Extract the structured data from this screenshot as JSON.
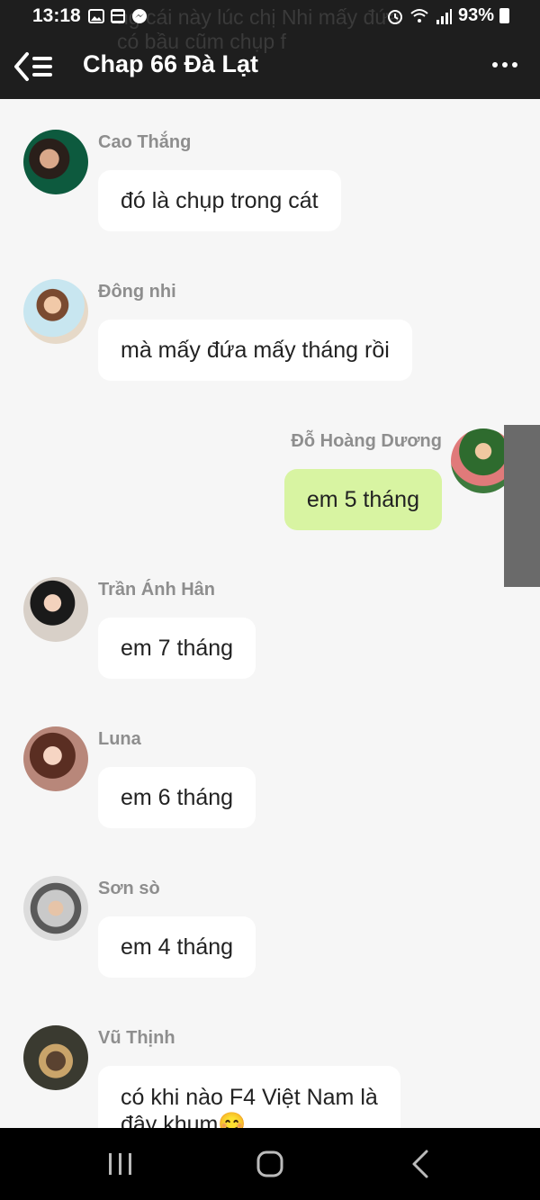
{
  "status_bar": {
    "time": "13:18",
    "battery": "93%"
  },
  "background_ghost_text": "ng cái này lúc chị Nhi mấy đứa có bầu cũm chụp f",
  "header": {
    "title": "Chap 66 Đà Lạt",
    "back_icon": "back-list-icon",
    "more_icon": "more-dots-icon"
  },
  "messages": [
    {
      "sender": "Cao Thắng",
      "text": "đó là chụp trong cát",
      "mine": false
    },
    {
      "sender": "Đông nhi",
      "text": "mà mấy đứa mấy tháng rồi",
      "mine": false
    },
    {
      "sender": "Đỗ Hoàng Dương",
      "text": "em 5 tháng",
      "mine": true
    },
    {
      "sender": "Trần Ánh Hân",
      "text": "em 7 tháng",
      "mine": false
    },
    {
      "sender": "Luna",
      "text": "em 6 tháng",
      "mine": false
    },
    {
      "sender": "Sơn sò",
      "text": "em 4 tháng",
      "mine": false
    },
    {
      "sender": "Vũ Thịnh",
      "text_line1": "có khi nào F4 Việt Nam là",
      "text_line2": "đây khum😊",
      "mine": false
    }
  ],
  "colors": {
    "header_bg": "#1e1e1e",
    "chat_bg": "#f6f6f6",
    "my_bubble": "#d8f4a2",
    "other_bubble": "#ffffff",
    "name_text": "#8e8e8e"
  },
  "navbar": {
    "recent_icon": "recent-apps-icon",
    "home_icon": "home-icon",
    "back_icon": "nav-back-icon"
  }
}
